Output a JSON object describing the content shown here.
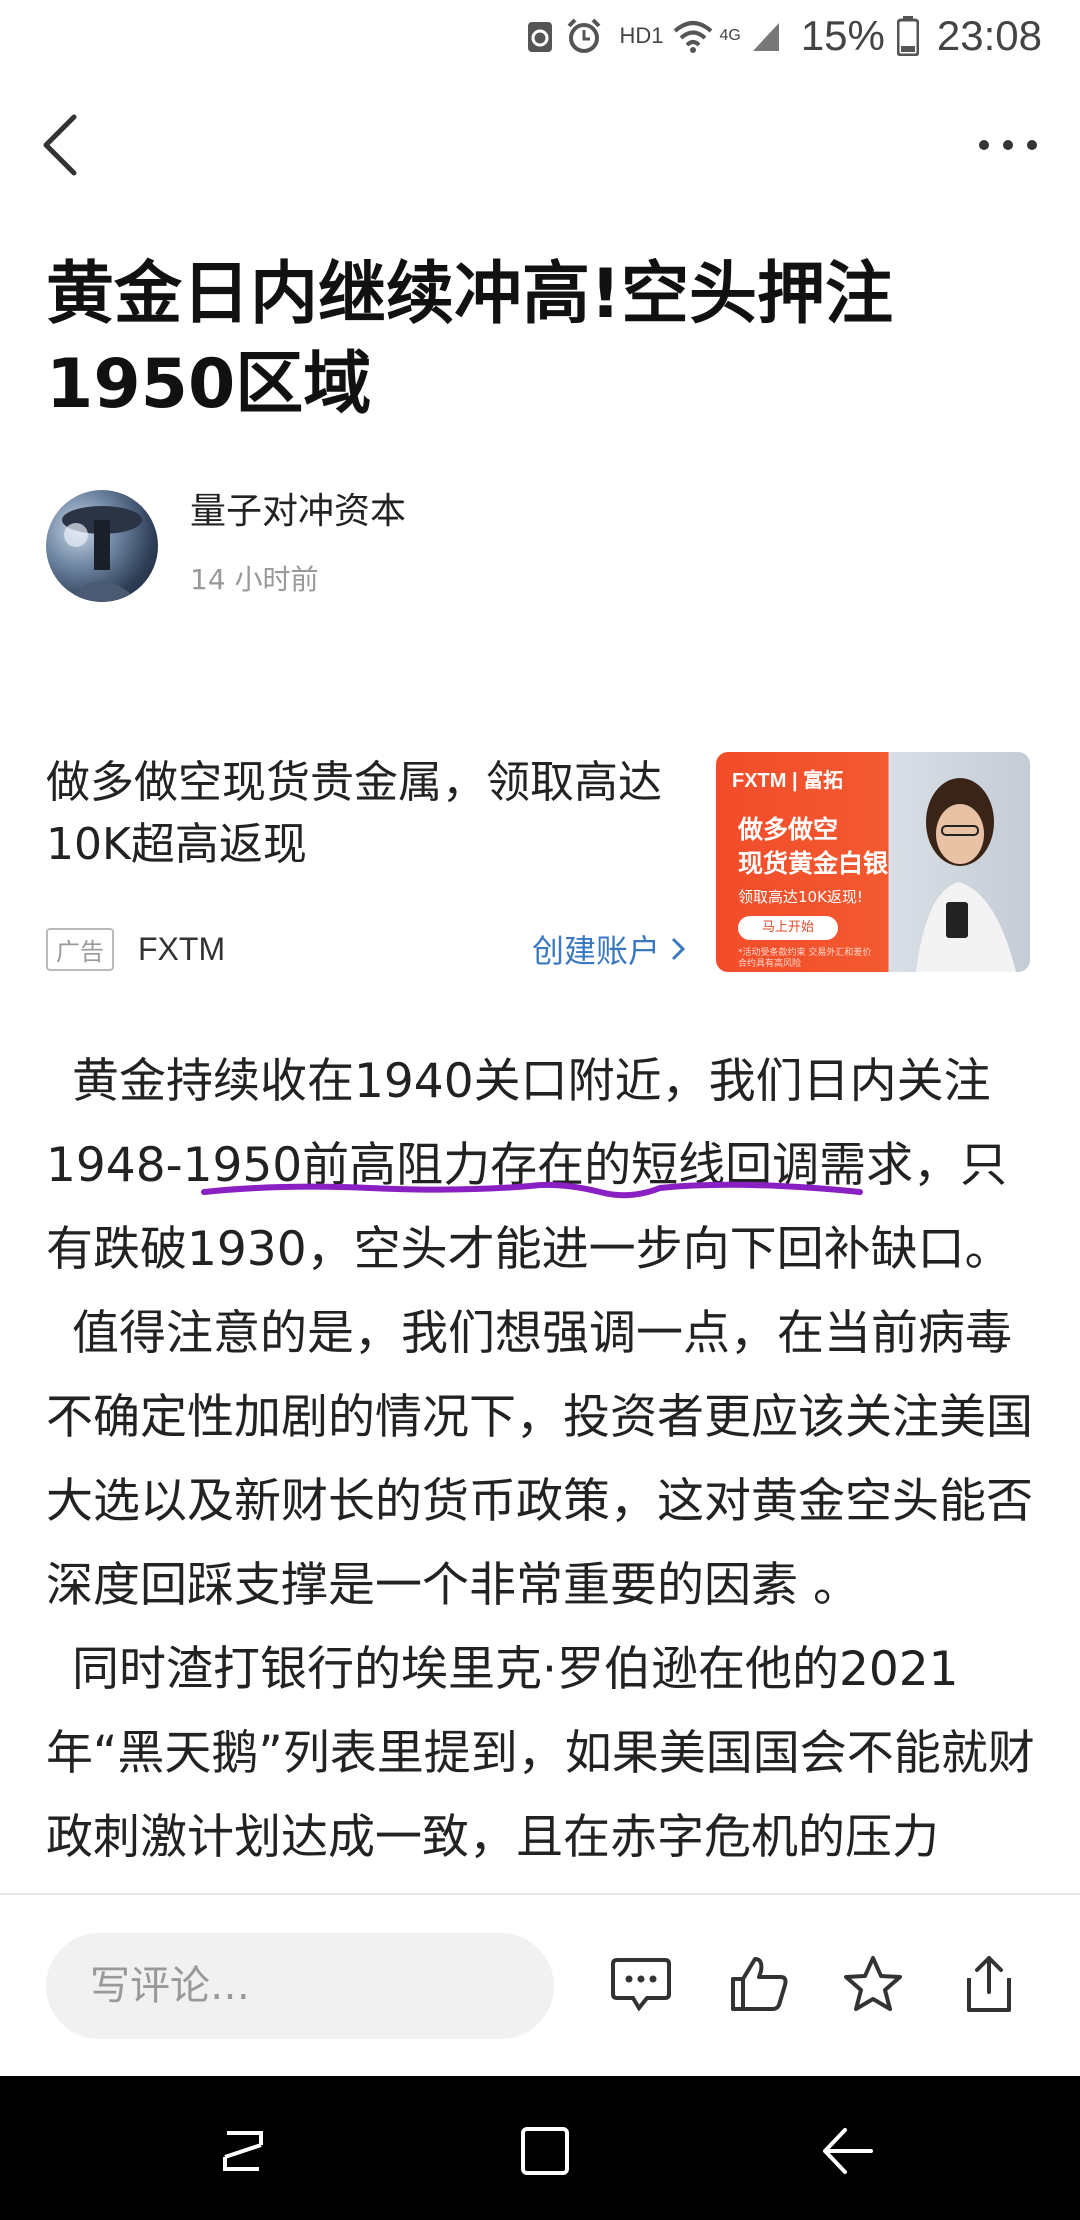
{
  "status_bar": {
    "hd_label": "HD1",
    "network_label": "4G",
    "battery": "15%",
    "time": "23:08"
  },
  "article": {
    "title": "黄金日内继续冲高!空头押注1950区域",
    "author": "量子对冲资本",
    "time": "14 小时前",
    "paragraphs": [
      "黄金持续收在1940关口附近，我们日内关注1948-1950前高阻力存在的短线回调需求，只有跌破1930，空头才能进一步向下回补缺口。",
      "值得注意的是，我们想强调一点，在当前病毒不确定性加剧的情况下，投资者更应该关注美国大选以及新财长的货币政策，这对黄金空头能否深度回踩支撑是一个非常重要的因素 。",
      "同时渣打银行的埃里克·罗伯逊在他的2021年“黑天鹅”列表里提到，如果美国国会不能就财政刺激计划达成一致，且在赤字危机的压力"
    ]
  },
  "ad": {
    "text": "做多做空现货贵金属，领取高达10K超高返现",
    "badge": "广告",
    "brand": "FXTM",
    "cta": "创建账户",
    "image": {
      "logo": "FXTM | 富拓",
      "line1": "做多做空",
      "line2": "现货黄金白银",
      "line3": "领取高达10K返现!",
      "button": "马上开始",
      "note": "*活动受条款约束 交易外汇和差价合约具有高风险"
    }
  },
  "bottom_bar": {
    "comment_placeholder": "写评论…"
  },
  "colors": {
    "link_blue": "#3a78c2",
    "annotation_purple": "#8a1fc4",
    "ad_orange": "#f24c2a"
  },
  "icons": [
    "back-arrow-icon",
    "more-icon",
    "comment-icon",
    "like-icon",
    "star-icon",
    "share-icon",
    "recent-apps-icon",
    "home-icon",
    "back-icon"
  ]
}
